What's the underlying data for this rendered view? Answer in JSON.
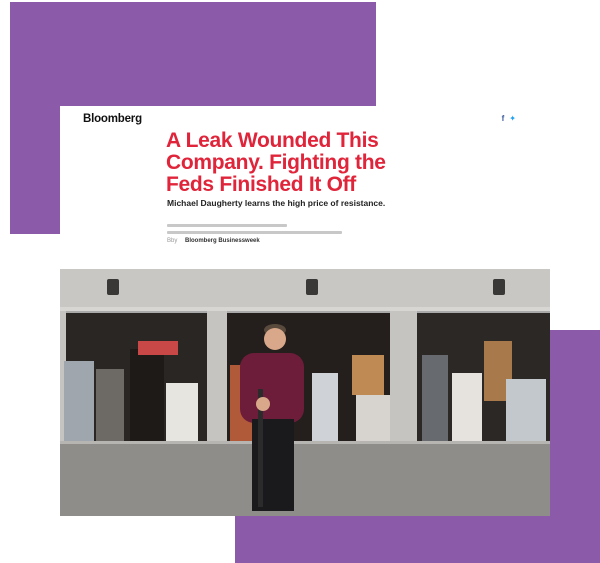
{
  "header": {
    "brand": "Bloomberg",
    "icons": [
      "facebook-icon",
      "twitter-icon"
    ]
  },
  "article": {
    "headline": "A Leak Wounded This Company. Fighting the Feds Finished It Off",
    "dek": "Michael Daugherty learns the high price of resistance.",
    "byline_label": "Bby",
    "byline_source": "Bloomberg Businessweek"
  },
  "colors": {
    "accent": "#8b5aa8",
    "headline": "#e0243a"
  }
}
